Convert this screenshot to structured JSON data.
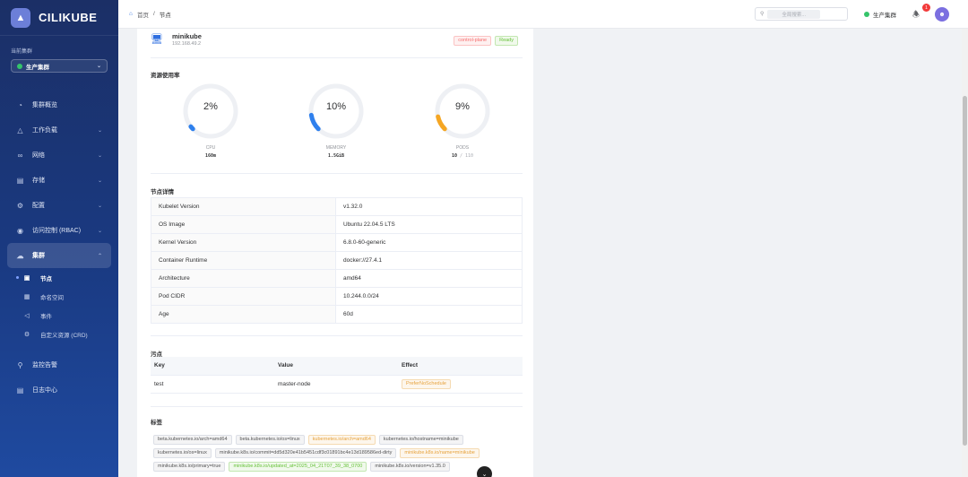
{
  "app": {
    "name": "CILIKUBE"
  },
  "sidebar": {
    "cluster_label": "当前集群",
    "cluster_value": "生产集群",
    "items": [
      {
        "label": "集群概览",
        "icon": "dashboard-icon"
      },
      {
        "label": "工作负载",
        "icon": "workload-icon"
      },
      {
        "label": "网络",
        "icon": "network-icon"
      },
      {
        "label": "存储",
        "icon": "storage-icon"
      },
      {
        "label": "配置",
        "icon": "settings-icon"
      },
      {
        "label": "访问控制 (RBAC)",
        "icon": "shield-icon"
      },
      {
        "label": "集群",
        "icon": "cloud-icon"
      }
    ],
    "sub_items": [
      {
        "label": "节点",
        "icon": "monitor-icon"
      },
      {
        "label": "命名空间",
        "icon": "namespace-icon"
      },
      {
        "label": "事件",
        "icon": "event-icon"
      },
      {
        "label": "自定义资源 (CRD)",
        "icon": "crd-icon"
      }
    ],
    "bottom_items": [
      {
        "label": "监控告警",
        "icon": "monitor-alert-icon"
      },
      {
        "label": "日志中心",
        "icon": "log-icon"
      }
    ]
  },
  "header": {
    "breadcrumb_home": "首页",
    "breadcrumb_sep": "/",
    "breadcrumb_current": "节点",
    "search_placeholder": "全局搜索...",
    "cluster": "生产集群",
    "notifications": "1"
  },
  "node": {
    "name": "minikube",
    "ip": "192.168.49.2",
    "tags": [
      "control-plane",
      "Ready"
    ]
  },
  "resources": {
    "title": "资源使用率",
    "cpu": {
      "label": "CPU",
      "percent": 2,
      "display": "2%",
      "detail": "160m"
    },
    "memory": {
      "label": "MEMORY",
      "percent": 10,
      "display": "10%",
      "detail": "1.5GiB"
    },
    "pods": {
      "label": "PODS",
      "percent": 9,
      "display": "9%",
      "detail_used": "10",
      "detail_sep": "/",
      "detail_total": "110"
    },
    "colors": {
      "cpu": "#2f80ed",
      "memory": "#2f80ed",
      "pods": "#f5a623",
      "track": "#eef0f4"
    }
  },
  "details": {
    "title": "节点详情",
    "rows": [
      {
        "key": "Kubelet Version",
        "value": "v1.32.0"
      },
      {
        "key": "OS Image",
        "value": "Ubuntu 22.04.5 LTS"
      },
      {
        "key": "Kernel Version",
        "value": "6.8.0-60-generic"
      },
      {
        "key": "Container Runtime",
        "value": "docker://27.4.1"
      },
      {
        "key": "Architecture",
        "value": "amd64"
      },
      {
        "key": "Pod CIDR",
        "value": "10.244.0.0/24"
      },
      {
        "key": "Age",
        "value": "60d"
      }
    ]
  },
  "taints": {
    "title": "污点",
    "columns": [
      "Key",
      "Value",
      "Effect"
    ],
    "rows": [
      {
        "key": "test",
        "value": "master-node",
        "effect": "PreferNoSchedule"
      }
    ]
  },
  "labels": {
    "title": "标签",
    "items": [
      {
        "text": "beta.kubernetes.io/arch=amd64",
        "style": "gray"
      },
      {
        "text": "beta.kubernetes.io/os=linux",
        "style": "gray"
      },
      {
        "text": "kubernetes.io/arch=amd64",
        "style": "orange"
      },
      {
        "text": "kubernetes.io/hostname=minikube",
        "style": "gray"
      },
      {
        "text": "kubernetes.io/os=linux",
        "style": "gray"
      },
      {
        "text": "minikube.k8s.io/commit=dd5d320e41b5451cdf3c01891bc4e13d189586ed-dirty",
        "style": "gray"
      },
      {
        "text": "minikube.k8s.io/name=minikube",
        "style": "orange"
      },
      {
        "text": "minikube.k8s.io/primary=true",
        "style": "gray"
      },
      {
        "text": "minikube.k8s.io/updated_at=2025_04_21T07_39_38_0700",
        "style": "green"
      },
      {
        "text": "minikube.k8s.io/version=v1.35.0",
        "style": "gray"
      }
    ]
  }
}
